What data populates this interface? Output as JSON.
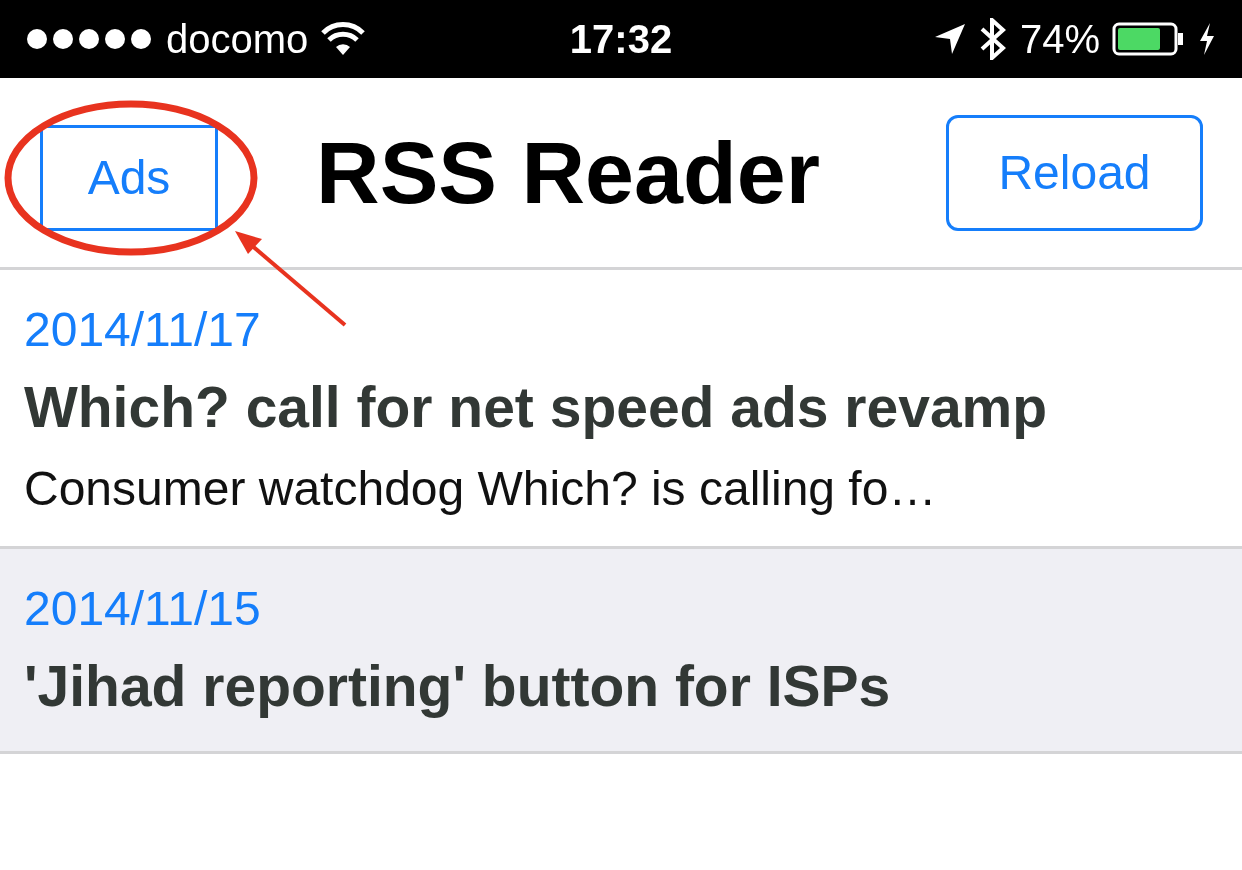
{
  "status_bar": {
    "carrier": "docomo",
    "time": "17:32",
    "battery": "74%"
  },
  "nav_bar": {
    "title": "RSS Reader",
    "left_button": "Ads",
    "right_button": "Reload"
  },
  "articles": [
    {
      "date": "2014/11/17",
      "title": "Which? call for net speed ads revamp",
      "summary": "Consumer watchdog Which? is calling fo…",
      "selected": false
    },
    {
      "date": "2014/11/15",
      "title": "'Jihad reporting' button for ISPs",
      "selected": true
    }
  ],
  "annotation": {
    "kind": "circle-arrow",
    "color": "#e8331f"
  }
}
